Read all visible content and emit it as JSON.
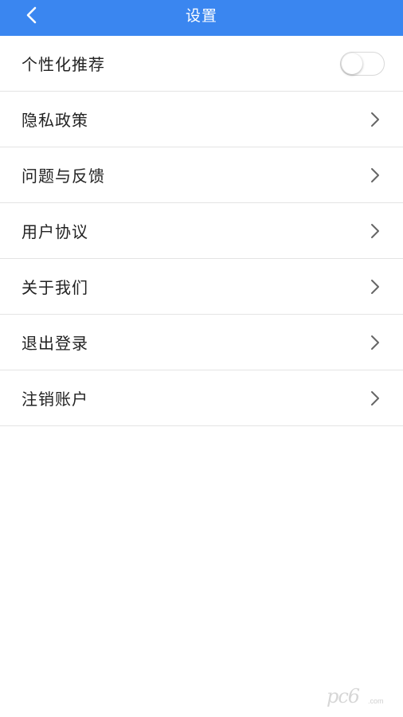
{
  "header": {
    "title": "设置",
    "background_color": "#3a86f0",
    "back_icon": "chevron-left-icon"
  },
  "settings": {
    "items": [
      {
        "label": "个性化推荐",
        "control": "toggle",
        "toggle_on": false
      },
      {
        "label": "隐私政策",
        "control": "chevron"
      },
      {
        "label": "问题与反馈",
        "control": "chevron"
      },
      {
        "label": "用户协议",
        "control": "chevron"
      },
      {
        "label": "关于我们",
        "control": "chevron"
      },
      {
        "label": "退出登录",
        "control": "chevron"
      },
      {
        "label": "注销账户",
        "control": "chevron"
      }
    ]
  },
  "watermark": {
    "text": "pc6",
    "domain": ".com"
  }
}
